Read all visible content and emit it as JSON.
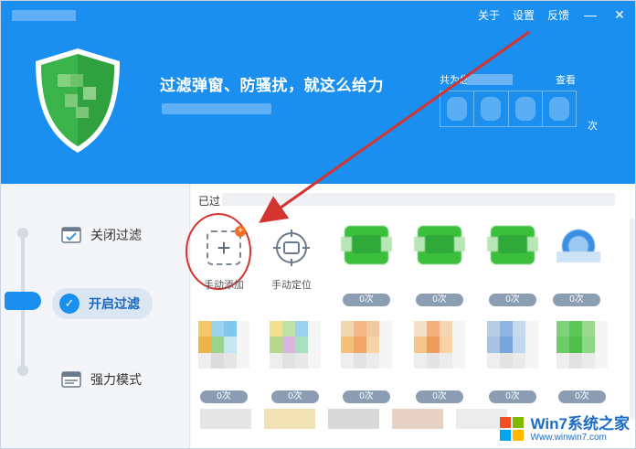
{
  "topbar": {
    "about": "关于",
    "settings": "设置",
    "feedback": "反馈",
    "minimize": "—",
    "close": "✕"
  },
  "header": {
    "slogan": "过滤弹窗、防骚扰，就这么给力",
    "stats_label": "共为您过",
    "view_label": "查看",
    "times_suffix": "次"
  },
  "left_panel": {
    "modes": [
      {
        "label": "关闭过滤",
        "active": false
      },
      {
        "label": "开启过滤",
        "active": true
      },
      {
        "label": "强力模式",
        "active": false
      }
    ]
  },
  "right_panel": {
    "heading": "已过",
    "tiles_row1": [
      {
        "caption": "手动添加",
        "kind": "add"
      },
      {
        "caption": "手动定位",
        "kind": "locate"
      },
      {
        "count": "0次",
        "color": "#3cbf3c"
      },
      {
        "count": "0次",
        "color": "#3cbf3c"
      },
      {
        "count": "0次",
        "color": "#3cbf3c"
      },
      {
        "count": "0次",
        "color": "#3a8fe3"
      }
    ],
    "tiles_row2": [
      {
        "count": "0次"
      },
      {
        "count": "0次"
      },
      {
        "count": "0次"
      },
      {
        "count": "0次"
      },
      {
        "count": "0次"
      },
      {
        "count": "0次"
      }
    ]
  },
  "watermark": {
    "brand": "Win7系统之家",
    "url": "Www.winwin7.com"
  },
  "colors": {
    "header_blue": "#1a8ff0",
    "shield_green": "#3ab34a",
    "annotation_red": "#d4342f"
  }
}
